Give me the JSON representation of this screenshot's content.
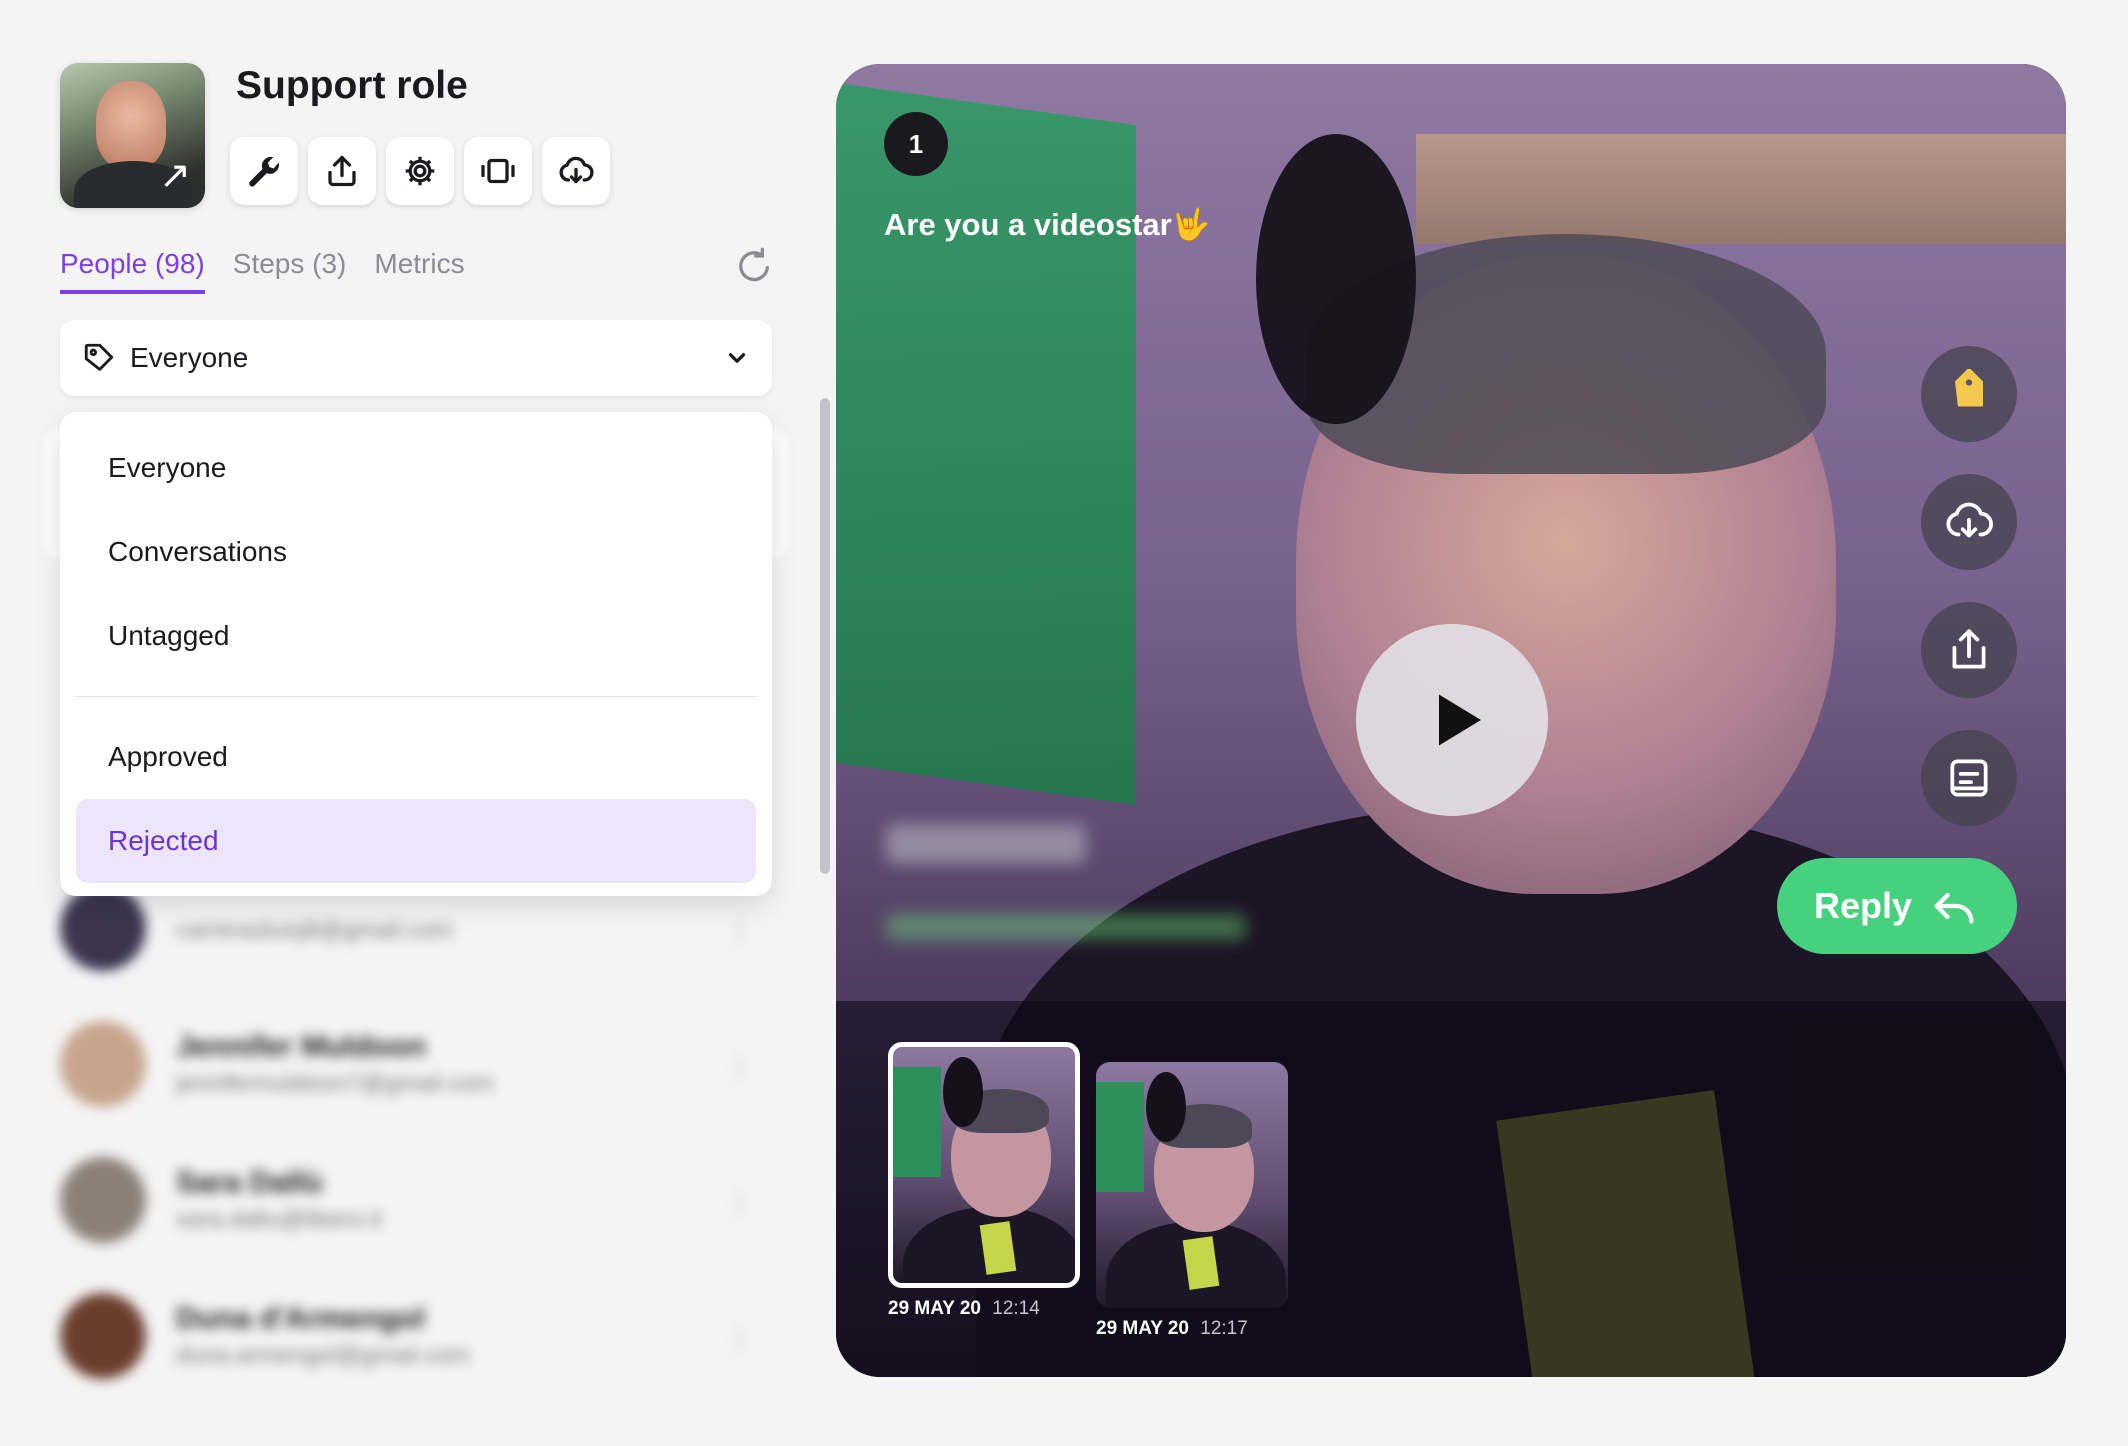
{
  "project": {
    "title": "Support role"
  },
  "toolbar": {
    "icons": [
      "wrench-icon",
      "share-icon",
      "gear-icon",
      "embed-icon",
      "cloud-download-icon"
    ]
  },
  "tabs": [
    {
      "label": "People (98)",
      "active": true
    },
    {
      "label": "Steps (3)",
      "active": false
    },
    {
      "label": "Metrics",
      "active": false
    }
  ],
  "filter": {
    "selected": "Everyone",
    "options_primary": [
      "Everyone",
      "Conversations",
      "Untagged"
    ],
    "options_secondary": [
      "Approved",
      "Rejected"
    ],
    "highlighted": "Rejected"
  },
  "people": [
    {
      "name": "",
      "email": "carrerasluisj8@gmail.com"
    },
    {
      "name": "Jennifer Muldoon",
      "email": "jennifermuldoon7@gmail.com"
    },
    {
      "name": "Sara Dallù",
      "email": "sara.dallu@libero.it"
    },
    {
      "name": "Duna d'Armengol",
      "email": "duna.armengol@gmail.com"
    }
  ],
  "video": {
    "step_number": "1",
    "question": "Are you a videostar🤟",
    "reply_label": "Reply",
    "side_actions": [
      "tag-icon",
      "cloud-download-icon",
      "share-icon",
      "transcript-icon"
    ],
    "thumbnails": [
      {
        "date": "29 MAY 20",
        "time": "12:14",
        "active": true
      },
      {
        "date": "29 MAY 20",
        "time": "12:17",
        "active": false
      }
    ]
  },
  "colors": {
    "accent": "#7b3fe4",
    "reply": "#46d17f",
    "selected_bg": "#ede6fb"
  }
}
